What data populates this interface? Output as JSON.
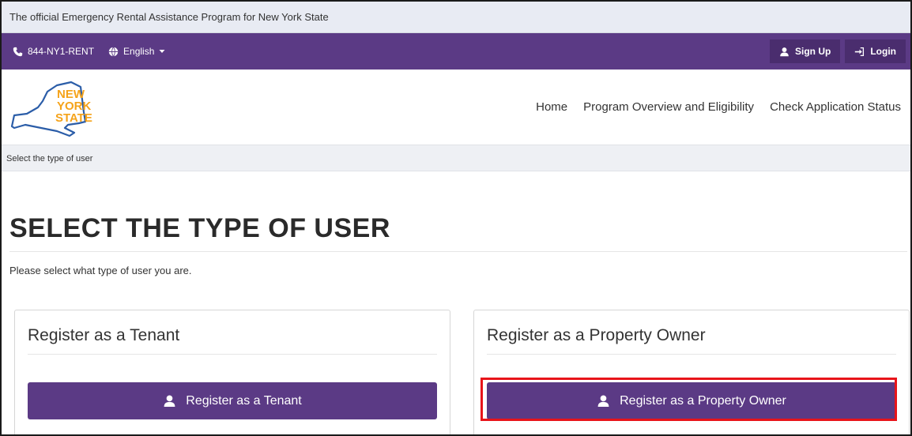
{
  "official_banner": "The official Emergency Rental Assistance Program for New York State",
  "topbar": {
    "phone": "844-NY1-RENT",
    "language": "English",
    "signup_label": "Sign Up",
    "login_label": "Login"
  },
  "logo": {
    "line1": "NEW",
    "line2": "YORK",
    "line3": "STATE"
  },
  "nav": {
    "home": "Home",
    "overview": "Program Overview and Eligibility",
    "status": "Check Application Status"
  },
  "breadcrumb": "Select the type of user",
  "page": {
    "title": "SELECT THE TYPE OF USER",
    "subtitle": "Please select what type of user you are."
  },
  "tenant_panel": {
    "title": "Register as a Tenant",
    "button_label": "Register as a Tenant"
  },
  "owner_panel": {
    "title": "Register as a Property Owner",
    "button_label": "Register as a Property Owner"
  },
  "colors": {
    "brand_purple": "#5b3a85",
    "dark_purple": "#4a2d6e",
    "logo_gold": "#f5a31a",
    "logo_blue": "#2b5da8",
    "highlight_red": "#e8141a"
  }
}
